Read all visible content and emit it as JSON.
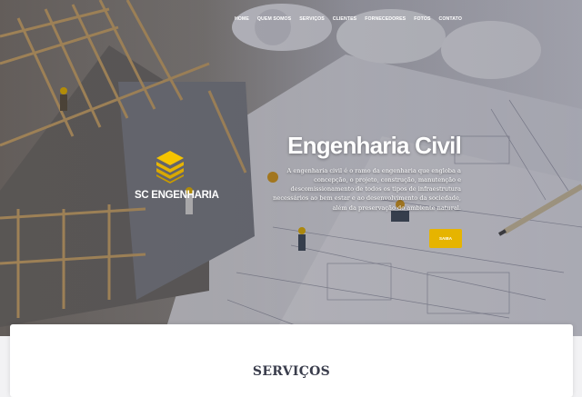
{
  "nav": {
    "items": [
      "HOME",
      "QUEM SOMOS",
      "SERVIÇOS",
      "CLIENTES",
      "FORNECEDORES",
      "FOTOS",
      "CONTATO"
    ]
  },
  "logo": {
    "text": "SC ENGENHARIA",
    "color": "#e6b400"
  },
  "hero": {
    "title": "Engenharia Civil",
    "description": "A engenharia civil é o ramo da engenharia que engloba a concepção, o projeto, construção, manutenção e descomissionamento de todos os tipos de infraestrutura necessários ao bem estar e ao desenvolvimento da sociedade, além da preservação do ambiente natural.",
    "button_label": "SAIBA"
  },
  "services": {
    "title": "SERVIÇOS"
  },
  "colors": {
    "accent": "#e6b400",
    "heading": "#3a3d4c"
  }
}
